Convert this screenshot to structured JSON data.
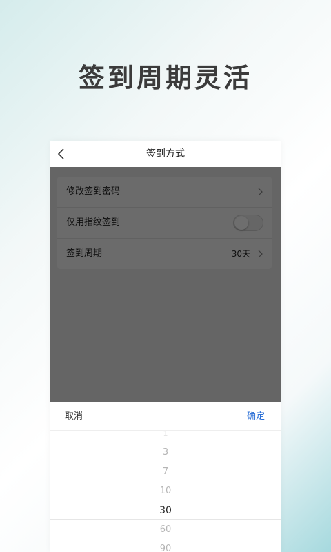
{
  "headline": "签到周期灵活",
  "nav": {
    "title": "签到方式",
    "back_icon": "chevron-left-icon"
  },
  "settings": {
    "rows": [
      {
        "label": "修改签到密码",
        "value": "",
        "control": "chevron-right-icon"
      },
      {
        "label": "仅用指纹签到",
        "value": "",
        "control": "toggle",
        "toggle_on": false
      },
      {
        "label": "签到周期",
        "value": "30天",
        "control": "chevron-right-icon"
      }
    ]
  },
  "picker": {
    "cancel_label": "取消",
    "confirm_label": "确定",
    "options": [
      "1",
      "3",
      "7",
      "10",
      "30",
      "60",
      "90"
    ],
    "selected": "30"
  },
  "colors": {
    "accent": "#2b6fd6",
    "overlay": "#656565",
    "headline": "#3b3b3b"
  }
}
